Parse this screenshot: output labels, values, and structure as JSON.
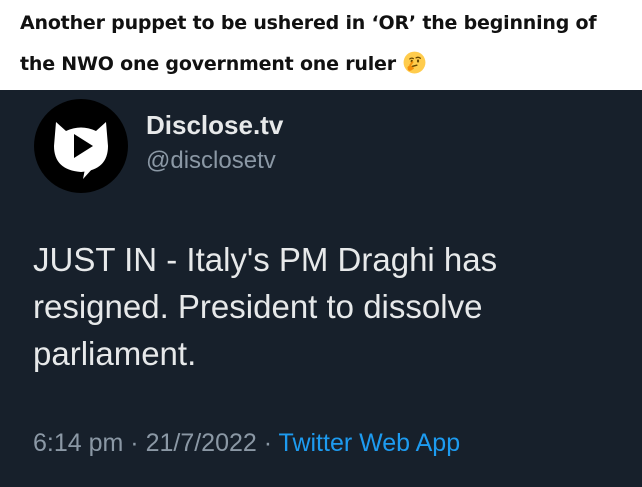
{
  "caption": {
    "line1": "Another puppet to be ushered in ‘OR’ the beginning of",
    "line2": "the NWO one government one ruler",
    "emoji": "thinking-face-emoji"
  },
  "tweet": {
    "avatar_icon": "disclose-tv-play-logo-icon",
    "display_name": "Disclose.tv",
    "handle": "@disclosetv",
    "text_lines": [
      "JUST IN - Italy's PM Draghi has",
      "resigned. President to dissolve",
      "parliament."
    ],
    "time": "6:14 pm",
    "separator": " · ",
    "date": "21/7/2022",
    "source": "Twitter Web App"
  },
  "colors": {
    "tweet_background": "#17202b",
    "primary_text": "#e7e9ea",
    "secondary_text": "#8b98a5",
    "link": "#1d9bf0"
  }
}
